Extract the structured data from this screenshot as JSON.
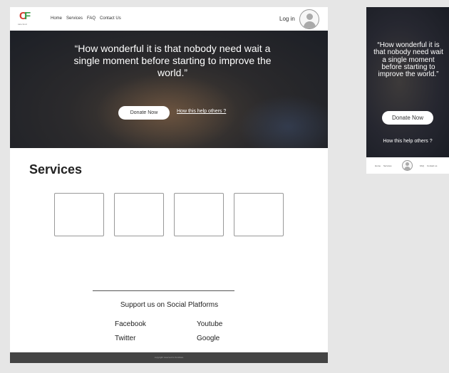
{
  "desktop": {
    "logo": {
      "c": "C",
      "f": "F",
      "tagline": "care fund"
    },
    "nav": {
      "items": [
        "Home",
        "Services",
        "FAQ",
        "Contact Us"
      ],
      "login": "Log in",
      "avatar_icon": "user-avatar-icon"
    },
    "hero": {
      "quote": "“How wonderful it is that nobody need wait a single moment before starting to improve the world.”",
      "donate": "Donate Now",
      "help": "How this help others ?"
    },
    "services": {
      "title": "Services"
    },
    "social": {
      "heading": "Support us on Social Platforms",
      "links": [
        "Facebook",
        "Youtube",
        "Twitter",
        "Google"
      ]
    },
    "footer": {
      "text": "copyright reserved to fundcare"
    }
  },
  "mobile": {
    "hero": {
      "quote": "“How wonderful it is that nobody need wait a single moment before starting to improve the world.”",
      "donate": "Donate Now",
      "help": "How this help others ?"
    },
    "nav": {
      "left": [
        "Home",
        "Services"
      ],
      "right": [
        "FAQ",
        "Contact us"
      ],
      "avatar_icon": "user-avatar-icon"
    }
  },
  "colors": {
    "logo_c": "#d33b2c",
    "logo_f": "#3c9d4a",
    "footer_bg": "#444444",
    "page_bg": "#e6e6e6"
  }
}
